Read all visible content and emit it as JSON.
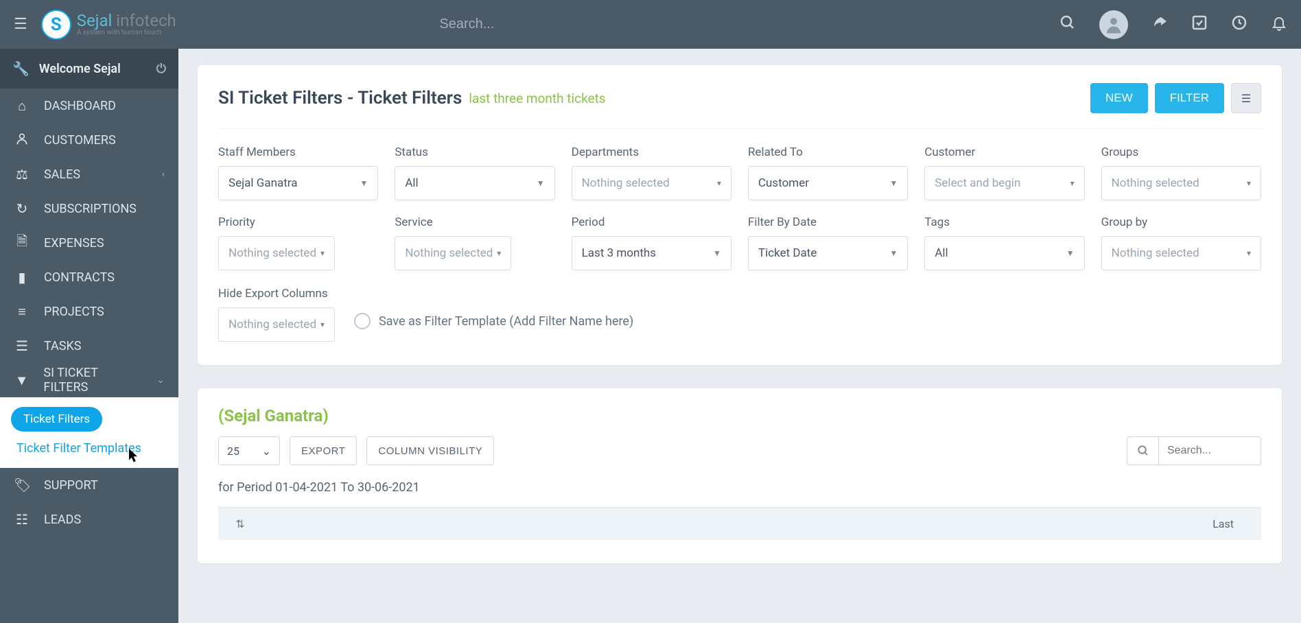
{
  "topbar": {
    "search_placeholder": "Search..."
  },
  "sidebar": {
    "welcome": "Welcome Sejal",
    "items": [
      {
        "icon": "home",
        "label": "DASHBOARD"
      },
      {
        "icon": "user",
        "label": "CUSTOMERS"
      },
      {
        "icon": "scale",
        "label": "SALES",
        "chev": true
      },
      {
        "icon": "refresh",
        "label": "SUBSCRIPTIONS"
      },
      {
        "icon": "file",
        "label": "EXPENSES"
      },
      {
        "icon": "doc",
        "label": "CONTRACTS"
      },
      {
        "icon": "bars",
        "label": "PROJECTS"
      },
      {
        "icon": "list",
        "label": "TASKS"
      },
      {
        "icon": "filter",
        "label": "SI TICKET FILTERS",
        "chev": true,
        "open": true
      },
      {
        "icon": "tag",
        "label": "SUPPORT"
      },
      {
        "icon": "leads",
        "label": "LEADS"
      }
    ],
    "sub": {
      "active": "Ticket Filters",
      "second": "Ticket Filter Templates"
    }
  },
  "page": {
    "title": "SI Ticket Filters - Ticket Filters",
    "subtitle": "last three month tickets",
    "new_btn": "NEW",
    "filter_btn": "FILTER"
  },
  "filters": {
    "staff": {
      "label": "Staff Members",
      "value": "Sejal Ganatra",
      "muted": false
    },
    "status": {
      "label": "Status",
      "value": "All",
      "muted": false
    },
    "departments": {
      "label": "Departments",
      "value": "Nothing selected",
      "muted": true
    },
    "related": {
      "label": "Related To",
      "value": "Customer",
      "muted": false
    },
    "customer": {
      "label": "Customer",
      "value": "Select and begin",
      "muted": true
    },
    "groups": {
      "label": "Groups",
      "value": "Nothing selected",
      "muted": true
    },
    "priority": {
      "label": "Priority",
      "value": "Nothing selected",
      "muted": true
    },
    "service": {
      "label": "Service",
      "value": "Nothing selected",
      "muted": true
    },
    "period": {
      "label": "Period",
      "value": "Last 3 months",
      "muted": false
    },
    "filter_by_date": {
      "label": "Filter By Date",
      "value": "Ticket Date",
      "muted": false
    },
    "tags": {
      "label": "Tags",
      "value": "All",
      "muted": false
    },
    "group_by": {
      "label": "Group by",
      "value": "Nothing selected",
      "muted": true
    },
    "hide_cols": {
      "label": "Hide Export Columns",
      "value": "Nothing selected",
      "muted": true
    },
    "save_template": "Save as Filter Template (Add Filter Name here)"
  },
  "results": {
    "title": "(Sejal Ganatra)",
    "page_size": "25",
    "export_btn": "EXPORT",
    "colvis_btn": "COLUMN VISIBILITY",
    "search_placeholder": "Search...",
    "period_line": "for Period 01-04-2021 To 30-06-2021",
    "col_last": "Last"
  },
  "logo": {
    "main_a": "Sejal",
    "main_b": " infotech",
    "tagline": "A system with human touch"
  }
}
